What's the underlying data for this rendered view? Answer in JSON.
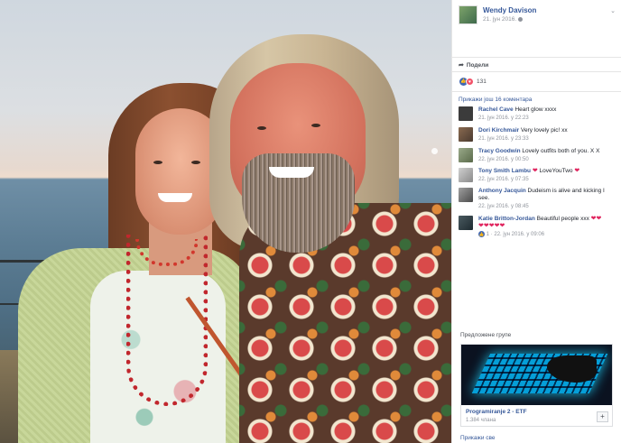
{
  "post": {
    "author": "Wendy Davison",
    "date": "21. јун 2016.",
    "share_label": "Подели",
    "reaction_count": "131",
    "more_comments": "Прикажи још 16 коментара"
  },
  "comments": [
    {
      "name": "Rachel Cave",
      "text": "Heart glow xxxx",
      "meta": "21. јун 2016. у 22:23",
      "avatar_color": "#3b3b3b"
    },
    {
      "name": "Dori Kirchmair",
      "text": "Very lovely pic! xx",
      "meta": "21. јун 2016. у 23:33",
      "avatar_color": "#6b5a4a"
    },
    {
      "name": "Tracy Goodwin",
      "text": "Lovely outfits both of you. X X",
      "meta": "22. јун 2016. у 00:50",
      "avatar_color": "#8a9a7a"
    },
    {
      "name": "Tony Smith Lambu",
      "text": "LoveYouTwo",
      "meta": "22. јун 2016. у 07:35",
      "avatar_color": "#b0b0b0"
    },
    {
      "name": "Anthony Jacquin",
      "text": "Dudeism is alive and kicking I see.",
      "meta": "22. јун 2016. у 08:45",
      "avatar_color": "#7a7a7a"
    },
    {
      "name": "Katie Britton-Jordan",
      "text": "Beautiful people xxx",
      "meta_likes": "1",
      "meta": "· 22. јун 2016. у 09:06",
      "avatar_color": "#2e3a40"
    }
  ],
  "suggested": {
    "title": "Предложене групе",
    "group_name": "Programiranje 2 - ETF",
    "members": "1.384 члана",
    "join": "+",
    "see_all": "Прикажи све"
  },
  "colors": {
    "link": "#365899",
    "like": "#4267b2",
    "love": "#f25268"
  }
}
